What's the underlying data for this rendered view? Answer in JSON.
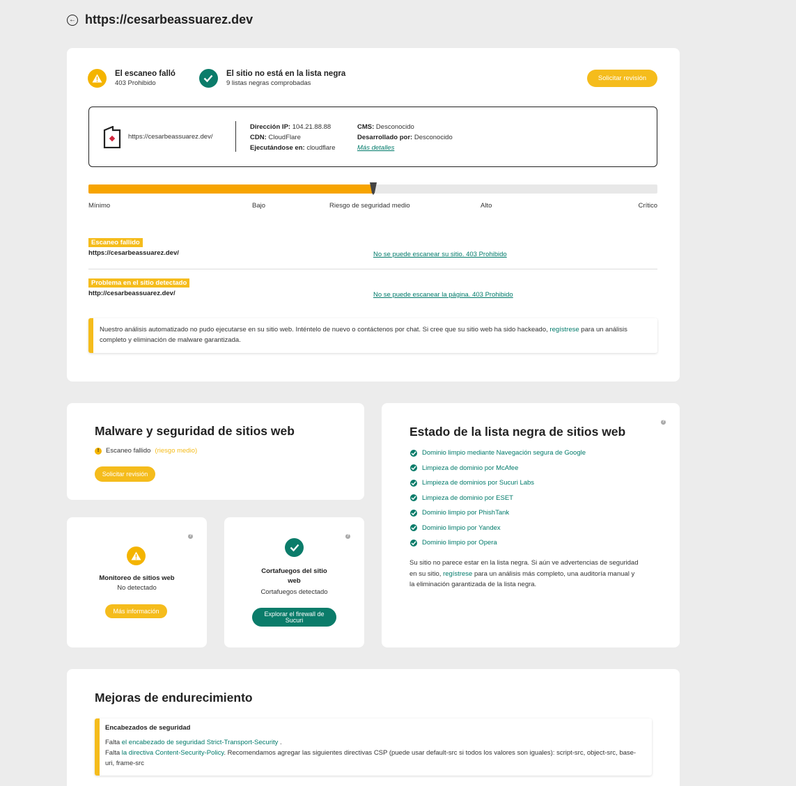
{
  "header": {
    "back_icon": "arrow-left-circle-icon",
    "title": "https://cesarbeassuarez.dev"
  },
  "scan_status": {
    "failed": {
      "icon": "warning-icon",
      "title": "El escaneo falló",
      "subtitle": "403 Prohibido"
    },
    "blacklist": {
      "icon": "check-circle-icon",
      "title": "El sitio no está en la lista negra",
      "subtitle": "9 listas negras comprobadas"
    },
    "review_button": "Solicitar revisión"
  },
  "site_info": {
    "url": "https://cesarbeassuarez.dev/",
    "ip_label": "Dirección IP:",
    "ip_value": "104.21.88.88",
    "cdn_label": "CDN:",
    "cdn_value": "CloudFlare",
    "running_label": "Ejecutándose en:",
    "running_value": "cloudflare",
    "cms_label": "CMS:",
    "cms_value": "Desconocido",
    "dev_label": "Desarrollado por:",
    "dev_value": "Desconocido",
    "more_details": "Más detalles"
  },
  "risk": {
    "level": 0.5,
    "labels": [
      "Mínimo",
      "Bajo",
      "Riesgo de seguridad medio",
      "Alto",
      "Crítico"
    ]
  },
  "issues": [
    {
      "tag": "Escaneo fallido",
      "url": "https://cesarbeassuarez.dev/",
      "link": "No se puede escanear su sitio. 403 Prohibido"
    },
    {
      "tag": "Problema en el sitio detectado",
      "url": "http://cesarbeassuarez.dev/",
      "link": "No se puede escanear la página. 403 Prohibido"
    }
  ],
  "notice": {
    "text_before": "Nuestro análisis automatizado no pudo ejecutarse en su sitio web. Inténtelo de nuevo o contáctenos por chat. Si cree que su sitio web ha sido hackeado, ",
    "link": "regístrese",
    "text_after": " para un análisis completo y eliminación de malware garantizada."
  },
  "malware": {
    "title": "Malware y seguridad de sitios web",
    "status": "Escaneo fallido",
    "risk": "(riesgo medio)",
    "button": "Solicitar revisión"
  },
  "blacklist": {
    "title": "Estado de la lista negra de sitios web",
    "items": [
      "Dominio limpio mediante Navegación segura de Google",
      "Limpieza de dominio por McAfee",
      "Limpieza de dominios por Sucuri Labs",
      "Limpieza de dominio por ESET",
      "Dominio limpio por PhishTank",
      "Dominio limpio por Yandex",
      "Dominio limpio por Opera"
    ],
    "note_before": "Su sitio no parece estar en la lista negra. Si aún ve advertencias de seguridad en su sitio, ",
    "note_link": "regístrese",
    "note_after": " para un análisis más completo, una auditoría manual y la eliminación garantizada de la lista negra."
  },
  "monitoring": {
    "title": "Monitoreo de sitios web",
    "status": "No detectado",
    "button": "Más información"
  },
  "firewall": {
    "title": "Cortafuegos del sitio web",
    "status": "Cortafuegos detectado",
    "button": "Explorar el firewall de Sucuri"
  },
  "hardening": {
    "title": "Mejoras de endurecimiento",
    "box_title": "Encabezados de seguridad",
    "line1_before": "Falta ",
    "line1_link": "el encabezado de seguridad Strict-Transport-Security",
    "line1_after": " .",
    "line2_before": "Falta ",
    "line2_link": "la directiva Content-Security-Policy",
    "line2_after": ". Recomendamos agregar las siguientes directivas CSP (puede usar default-src si todos los valores son iguales): script-src, object-src, base-uri, frame-src"
  },
  "colors": {
    "accent_yellow": "#f5bc1c",
    "accent_green": "#0b7c6a",
    "risk_orange": "#f7a400"
  }
}
